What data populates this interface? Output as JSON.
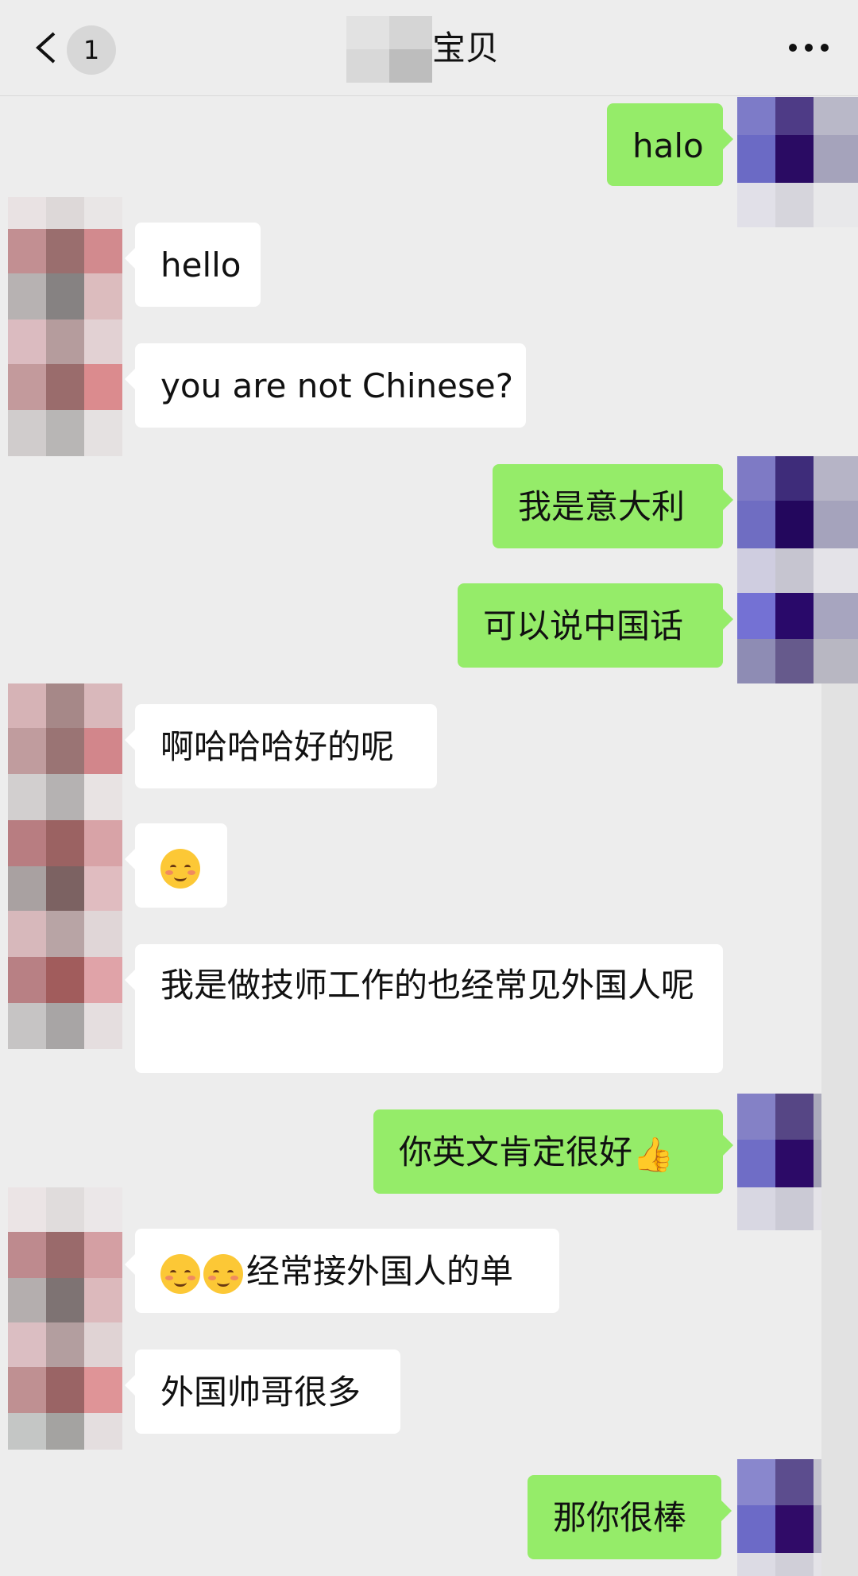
{
  "header": {
    "back_icon": "chevron-left-icon",
    "unread_count": "1",
    "title": "宝贝",
    "more_icon": "more-dots-icon"
  },
  "messages": [
    {
      "side": "out",
      "text": "halo"
    },
    {
      "side": "in",
      "text": "hello"
    },
    {
      "side": "in",
      "text": "you are not Chinese?"
    },
    {
      "side": "out",
      "text": "我是意大利"
    },
    {
      "side": "out",
      "text": "可以说中国话"
    },
    {
      "side": "in",
      "text": "啊哈哈哈好的呢"
    },
    {
      "side": "in",
      "emoji": "blushing-smile-emoji"
    },
    {
      "side": "in",
      "text": "我是做技师工作的也经常见外国人呢"
    },
    {
      "side": "out",
      "text": "你英文肯定很好",
      "emoji": "thumbs-up-emoji"
    },
    {
      "side": "in",
      "text": "经常接外国人的单",
      "emoji": "blushing-smile-emoji x2"
    },
    {
      "side": "in",
      "text": "外国帅哥很多"
    },
    {
      "side": "out",
      "text": "那你很棒"
    }
  ],
  "colors": {
    "background": "#ededed",
    "outgoing_bubble": "#95ec69",
    "incoming_bubble": "#ffffff"
  }
}
